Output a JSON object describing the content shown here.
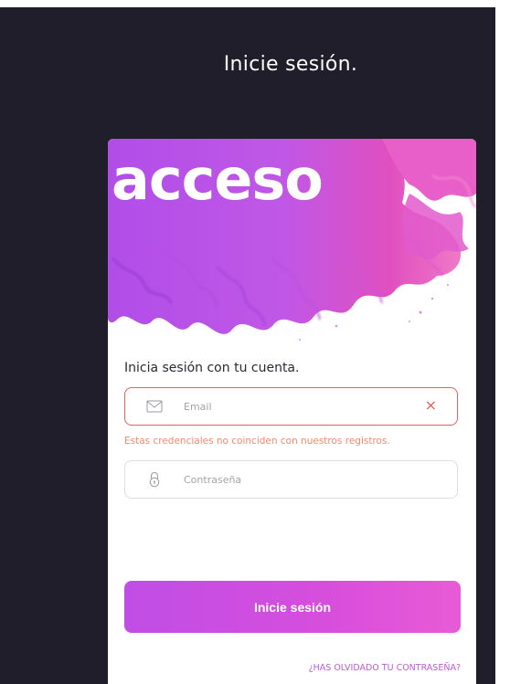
{
  "page": {
    "title": "Inicie sesión."
  },
  "card": {
    "brand": "acceso",
    "subtitle": "Inicia sesión con tu cuenta.",
    "email": {
      "placeholder": "Email",
      "icon": "mail-icon",
      "error": "Estas credenciales no coinciden con nuestros registros."
    },
    "password": {
      "placeholder": "Contraseña",
      "icon": "lock-icon"
    },
    "submit_label": "Inicie sesión",
    "forgot_label": "¿HAS OLVIDADO TU CONTRASEÑA?"
  },
  "colors": {
    "background": "#1f1e2a",
    "accent": "#c955df",
    "error": "#e8605c",
    "error_text": "#ee8a6f",
    "link": "#c259d3"
  }
}
